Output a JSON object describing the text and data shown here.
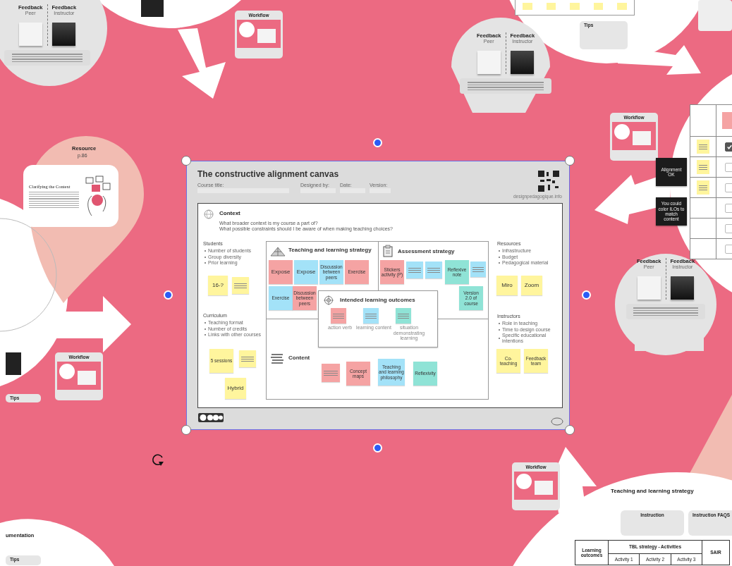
{
  "canvas_frame": {
    "title": "The constructive alignment canvas",
    "fields": [
      "Course title:",
      "Designed by:",
      "Date:",
      "Version:"
    ],
    "website": "designpedagogique.info",
    "context": {
      "heading": "Context",
      "questions": [
        "What broader context is my course a part of?",
        "What possible constraints should I be aware of when making teaching choices?"
      ]
    },
    "side_sections": [
      {
        "heading": "Students",
        "items": [
          "Number of students",
          "Group diversity",
          "Prior learning"
        ]
      },
      {
        "heading": "Curriculum",
        "items": [
          "Teaching format",
          "Number of credits",
          "Links with other courses"
        ]
      },
      {
        "heading": "Resources",
        "items": [
          "Infrastructure",
          "Budget",
          "Pedagogical material"
        ]
      },
      {
        "heading": "Instructors",
        "items": [
          "Role in teaching",
          "Time to design course",
          "Specific educational intentions"
        ]
      }
    ],
    "teaching_strategy": {
      "heading": "Teaching and learning strategy"
    },
    "assessment_strategy": {
      "heading": "Assessment strategy"
    },
    "learning_outcomes": {
      "heading": "Intended learning outcomes",
      "labels": [
        "action verb",
        "learning content",
        "situation demonstrating learning"
      ]
    },
    "content": {
      "heading": "Content"
    },
    "stickies": [
      {
        "kind": "text",
        "text": "16-?",
        "color": "#fff59d"
      },
      {
        "kind": "lines",
        "color": "#fff59d"
      },
      {
        "kind": "lines",
        "color": "#fff59d"
      },
      {
        "kind": "text",
        "text": "5 sessions",
        "color": "#fff59d"
      },
      {
        "kind": "text",
        "text": "Hybrid",
        "color": "#fff59d"
      },
      {
        "kind": "text",
        "text": "Expose",
        "color": "#f5a3a3"
      },
      {
        "kind": "text",
        "text": "Expose",
        "color": "#a3e2f8"
      },
      {
        "kind": "text",
        "text": "Discussion between peers",
        "color": "#a3e2f8"
      },
      {
        "kind": "text",
        "text": "Exercise",
        "color": "#f5a3a3"
      },
      {
        "kind": "text",
        "text": "Exercise",
        "color": "#a3e2f8"
      },
      {
        "kind": "text",
        "text": "Discussion between peers",
        "color": "#f5a3a3"
      },
      {
        "kind": "text",
        "text": "Stickers activity (P)",
        "color": "#f5a3a3"
      },
      {
        "kind": "lines",
        "color": "#a3e2f8"
      },
      {
        "kind": "lines",
        "color": "#a3e2f8"
      },
      {
        "kind": "text",
        "text": "Reflexive note",
        "color": "#8fe3d6"
      },
      {
        "kind": "lines",
        "color": "#a3e2f8"
      },
      {
        "kind": "text",
        "text": "Version 2.0 of course",
        "color": "#8fe3d6"
      },
      {
        "kind": "lines",
        "color": "#f5a3a3"
      },
      {
        "kind": "lines",
        "color": "#a3e2f8"
      },
      {
        "kind": "lines",
        "color": "#8fe3d6"
      },
      {
        "kind": "lines",
        "color": "#f5a3a3"
      },
      {
        "kind": "text",
        "text": "Concept maps",
        "color": "#f5a3a3"
      },
      {
        "kind": "text",
        "text": "Teaching and learning philosophy",
        "color": "#a3e2f8"
      },
      {
        "kind": "text",
        "text": "Reflexivity",
        "color": "#8fe3d6"
      },
      {
        "kind": "text",
        "text": "Miro",
        "color": "#fff59d"
      },
      {
        "kind": "text",
        "text": "Zoom",
        "color": "#fff59d"
      },
      {
        "kind": "text",
        "text": "Co-teaching",
        "color": "#fff59d"
      },
      {
        "kind": "text",
        "text": "Feedback team",
        "color": "#fff59d"
      }
    ]
  },
  "feedback_cards": [
    {
      "left_title": "Feedback",
      "left_sub": "Peer",
      "right_title": "Feedback",
      "right_sub": "Instructor"
    },
    {
      "left_title": "Feedback",
      "left_sub": "Peer",
      "right_title": "Feedback",
      "right_sub": "Instructor"
    },
    {
      "left_title": "Feedback",
      "left_sub": "Peer",
      "right_title": "Feedback",
      "right_sub": "Instructor"
    }
  ],
  "workflow_cards": [
    {
      "title": "Workflow"
    },
    {
      "title": "Workflow"
    },
    {
      "title": "Workflow"
    },
    {
      "title": "Workflow"
    }
  ],
  "resource": {
    "title": "Resource",
    "page": "p.86",
    "document_title": "Clarifying the Context"
  },
  "tips": [
    "Tips",
    "Tips",
    "Tips"
  ],
  "black_notes": [
    "Alignment OK",
    "You could color ILOs to match content"
  ],
  "checklist": [
    {
      "checked": true
    },
    {
      "checked": false
    },
    {
      "checked": false
    },
    {
      "checked": false
    },
    {
      "checked": false
    },
    {
      "checked": false
    }
  ],
  "documentation_heading": "umentation",
  "strategy_panel": {
    "title": "Teaching and learning strategy",
    "cards": [
      "Instruction",
      "Instruction FAQS"
    ],
    "table": {
      "outcomes": "Learning outcomes",
      "activities": "TBL strategy - Activities",
      "last": "SAIR",
      "activity_columns": [
        "Activity 1",
        "Activity 2",
        "Activity 3"
      ]
    }
  }
}
